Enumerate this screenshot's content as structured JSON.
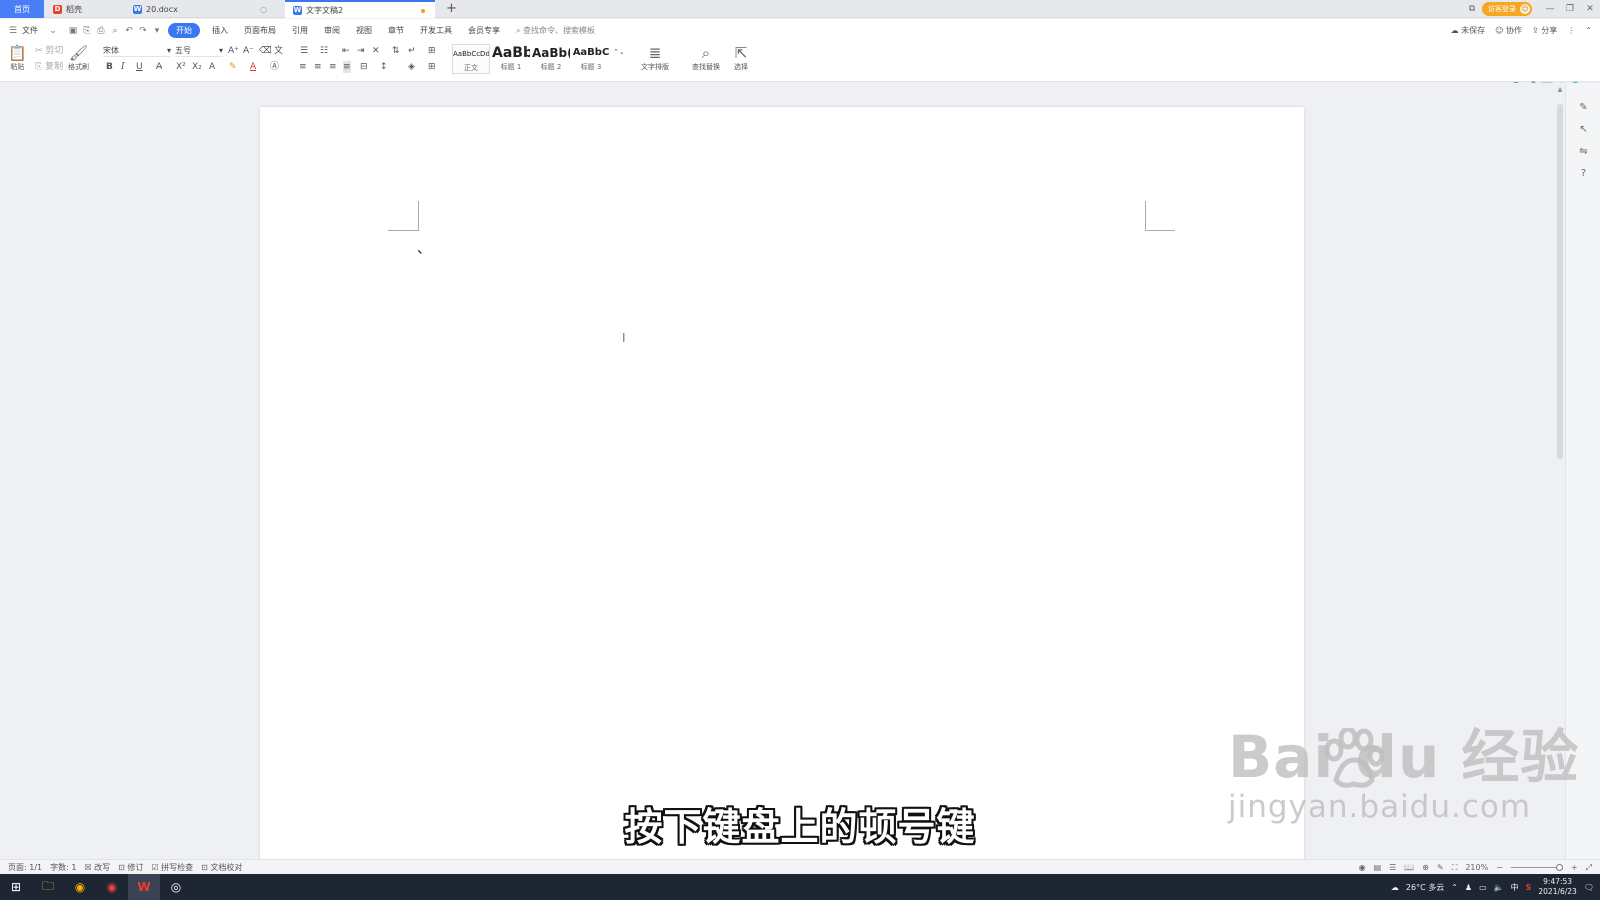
{
  "tabs": {
    "home": "首页",
    "docer": "稻壳",
    "file1": "20.docx",
    "file2": "文字文稿2",
    "add": "+"
  },
  "window": {
    "login": "访客登录",
    "minimize": "—",
    "restore": "❐",
    "close": "✕"
  },
  "menu": {
    "file": "文件",
    "items": [
      "开始",
      "插入",
      "页面布局",
      "引用",
      "审阅",
      "视图",
      "章节",
      "开发工具",
      "会员专享"
    ],
    "search": "查找命令、搜索模板",
    "unsaved": "未保存",
    "collab": "协作",
    "share": "分享"
  },
  "ribbon": {
    "paste": "粘贴",
    "cut": "剪切",
    "copy": "复制",
    "format_painter": "格式刷",
    "font_name": "宋体",
    "font_size": "五号",
    "styles": [
      {
        "preview": "AaBbCcDd",
        "name": "正文"
      },
      {
        "preview": "AaBb",
        "name": "标题 1"
      },
      {
        "preview": "AaBb(",
        "name": "标题 2"
      },
      {
        "preview": "AaBbC",
        "name": "标题 3"
      }
    ],
    "text_layout": "文字排版",
    "find_replace": "查找替换",
    "select": "选择"
  },
  "document": {
    "typed_mark": "、"
  },
  "caption": "按下键盘上的顿号键",
  "watermark": {
    "brand": "Bai  du 经验",
    "url": "jingyan.baidu.com"
  },
  "status": {
    "page": "页面: 1/1",
    "words": "字数: 1",
    "rewrite": "改写",
    "revise": "修订",
    "spell": "拼写检查",
    "proof": "文档校对",
    "zoom": "210%",
    "zoom_fraction": 0.92
  },
  "taskbar": {
    "weather": "26°C 多云",
    "ime": "中",
    "time": "9:47:53",
    "date": "2021/6/23"
  },
  "colors": {
    "accent": "#3b78f0",
    "login": "#f5a623",
    "taskbar": "#1e2533"
  }
}
